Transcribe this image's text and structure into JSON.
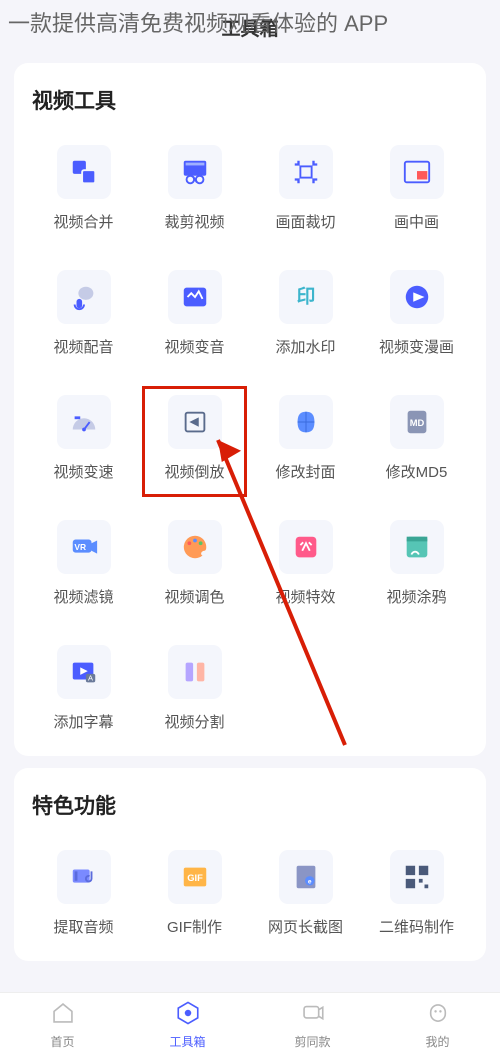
{
  "header": {
    "overlay_text": "一款提供高清免费视频观看体验的 APP",
    "page_title": "工具箱"
  },
  "sections": {
    "video_tools": {
      "title": "视频工具",
      "items": [
        {
          "id": "video-merge",
          "label": "视频合并"
        },
        {
          "id": "video-crop",
          "label": "裁剪视频"
        },
        {
          "id": "frame-crop",
          "label": "画面裁切"
        },
        {
          "id": "pip",
          "label": "画中画"
        },
        {
          "id": "dubbing",
          "label": "视频配音"
        },
        {
          "id": "voice-change",
          "label": "视频变音"
        },
        {
          "id": "watermark",
          "label": "添加水印"
        },
        {
          "id": "to-comic",
          "label": "视频变漫画"
        },
        {
          "id": "speed",
          "label": "视频变速"
        },
        {
          "id": "reverse",
          "label": "视频倒放"
        },
        {
          "id": "cover",
          "label": "修改封面"
        },
        {
          "id": "md5",
          "label": "修改MD5"
        },
        {
          "id": "filter",
          "label": "视频滤镜"
        },
        {
          "id": "color",
          "label": "视频调色"
        },
        {
          "id": "effects",
          "label": "视频特效"
        },
        {
          "id": "doodle",
          "label": "视频涂鸦"
        },
        {
          "id": "subtitle",
          "label": "添加字幕"
        },
        {
          "id": "split",
          "label": "视频分割"
        }
      ]
    },
    "special": {
      "title": "特色功能",
      "items": [
        {
          "id": "extract-audio",
          "label": "提取音频"
        },
        {
          "id": "gif",
          "label": "GIF制作"
        },
        {
          "id": "web-shot",
          "label": "网页长截图"
        },
        {
          "id": "qr",
          "label": "二维码制作"
        }
      ]
    }
  },
  "nav": {
    "items": [
      {
        "id": "home",
        "label": "首页"
      },
      {
        "id": "tools",
        "label": "工具箱",
        "active": true
      },
      {
        "id": "same",
        "label": "剪同款"
      },
      {
        "id": "mine",
        "label": "我的"
      }
    ]
  },
  "highlighted_tool": "reverse"
}
